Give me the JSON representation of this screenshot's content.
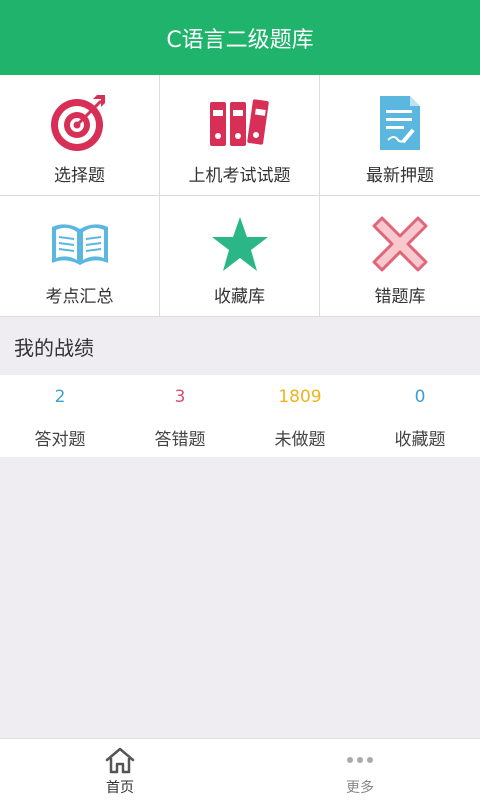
{
  "header": {
    "title": "C语言二级题库"
  },
  "menu": {
    "items": [
      {
        "label": "选择题",
        "icon": "target-icon"
      },
      {
        "label": "上机考试试题",
        "icon": "binders-icon"
      },
      {
        "label": "最新押题",
        "icon": "document-pen-icon"
      },
      {
        "label": "考点汇总",
        "icon": "open-book-icon"
      },
      {
        "label": "收藏库",
        "icon": "star-icon"
      },
      {
        "label": "错题库",
        "icon": "cross-icon"
      }
    ]
  },
  "record": {
    "title": "我的战绩",
    "stats": [
      {
        "value": "2",
        "label": "答对题",
        "color": "#3d9fd0"
      },
      {
        "value": "3",
        "label": "答错题",
        "color": "#d9506a"
      },
      {
        "value": "1809",
        "label": "未做题",
        "color": "#f0b41c"
      },
      {
        "value": "0",
        "label": "收藏题",
        "color": "#3d9fd0"
      }
    ]
  },
  "nav": {
    "home_label": "首页",
    "more_label": "更多",
    "active_color": "#333333",
    "inactive_color": "#888888"
  },
  "colors": {
    "header": "#1fb36b",
    "background": "#efedf1"
  }
}
